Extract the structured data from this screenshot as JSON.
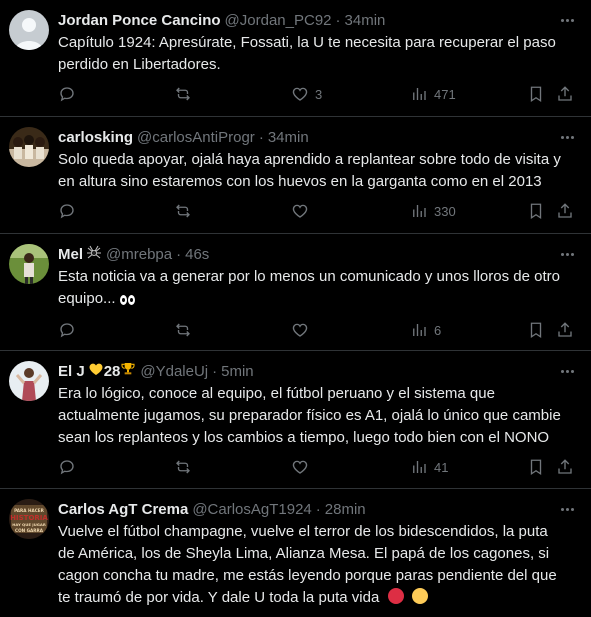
{
  "tweets": [
    {
      "name": "Jordan Ponce Cancino",
      "handle": "@Jordan_PC92",
      "time": "34min",
      "text": "Capítulo 1924: Apresúrate, Fossati, la U te necesita para recuperar el paso perdido en Libertadores.",
      "likes": "3",
      "views": "471"
    },
    {
      "name": "carlosking",
      "handle": "@carlosAntiProgr",
      "time": "34min",
      "text": "Solo queda apoyar, ojalá haya aprendido a replantear sobre todo de visita y en altura sino estaremos con los huevos en la garganta como en el 2013",
      "likes": "",
      "views": "330"
    },
    {
      "name": "Mel",
      "name_emoji": "spider-icon",
      "handle": "@mrebpa",
      "time": "46s",
      "text": "Esta noticia va a generar por lo menos un comunicado y unos lloros de otro equipo...",
      "text_emoji": "eyes-icon",
      "likes": "",
      "views": "6"
    },
    {
      "name": "El J",
      "name_suffix": "28",
      "name_emojis": [
        "yellow-heart-icon",
        "trophy-icon"
      ],
      "handle": "@YdaleUj",
      "time": "5min",
      "text": "Era lo lógico, conoce al equipo, el fútbol peruano y el sistema que actualmente jugamos, su preparador físico es A1, ojalá lo único que cambie sean los replanteos y los cambios a tiempo, luego todo bien con el NONO",
      "likes": "",
      "views": "41"
    },
    {
      "name": "Carlos AgT Crema",
      "handle": "@CarlosAgT1924",
      "time": "28min",
      "text": "Vuelve el fútbol champagne, vuelve el terror de los bidescendidos, la puta de América, los de Sheyla Lima, Alianza Mesa. El papá de los cagones, si cagon concha tu madre, me estás leyendo porque paras pendiente del que te traumó de por vida. Y dale U toda la puta vida",
      "text_emojis": [
        "red-circle-icon",
        "yellow-circle-icon"
      ],
      "avatar_text": "PARA HACER HISTORIA HAY QUE JUGAR CON GARRA"
    }
  ],
  "separator": "·",
  "colors": {
    "background": "#000000",
    "text": "#e7e9ea",
    "muted": "#71767b",
    "divider": "#2f3336"
  }
}
